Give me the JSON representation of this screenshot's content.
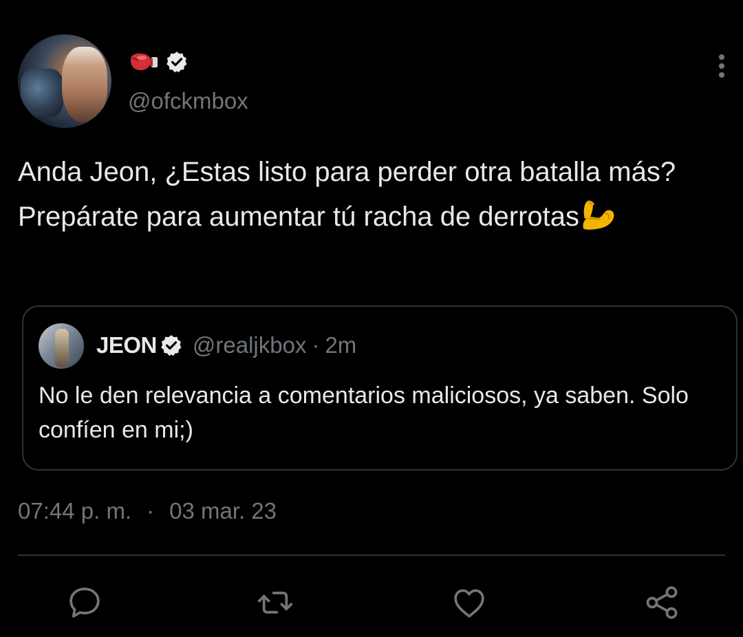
{
  "author": {
    "display_name_icons": [
      "boxing-glove-icon",
      "verified-icon"
    ],
    "handle": "@ofckmbox"
  },
  "tweet": {
    "text": "Anda Jeon, ¿Estas listo para perder otra batalla más? Prepárate para aumentar tú racha de derrotas",
    "trailing_emoji": "flexed-biceps-icon",
    "time": "07:44 p. m.",
    "separator": "·",
    "date": "03 mar. 23"
  },
  "quoted": {
    "name": "JEON",
    "handle": "@realjkbox",
    "separator": "·",
    "time": "2m",
    "text": "No le den relevancia a comentarios maliciosos, ya saben. Solo confíen en mi;)"
  },
  "actions": [
    "reply-icon",
    "retweet-icon",
    "like-icon",
    "share-icon"
  ],
  "colors": {
    "background": "#000000",
    "text": "#e7e9ea",
    "muted": "#71767b",
    "border": "#2f3336"
  }
}
